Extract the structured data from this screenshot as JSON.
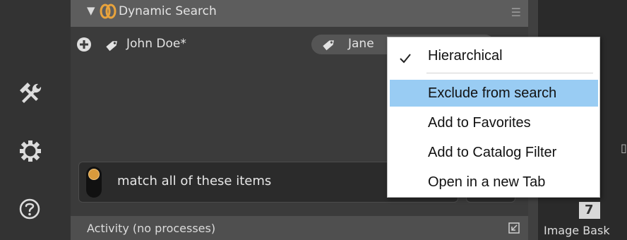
{
  "panel": {
    "header_title": "Dynamic Search",
    "tag_primary": "John Doe*",
    "tag_secondary": "Jane",
    "match_label": "match all of these items"
  },
  "activity": {
    "label": "Activity (no processes)"
  },
  "basket": {
    "count": "7",
    "label": "Image Bask"
  },
  "context_menu": {
    "items": [
      {
        "label": "Hierarchical",
        "checked": true
      },
      {
        "label": "Exclude from search",
        "highlighted": true
      },
      {
        "label": "Add to Favorites"
      },
      {
        "label": "Add to Catalog Filter"
      },
      {
        "label": "Open in a new Tab"
      }
    ]
  },
  "sidebar": {
    "icons": [
      "tools-icon",
      "gear-icon",
      "help-icon"
    ]
  },
  "colors": {
    "accent_orange": "#e8a33c",
    "menu_highlight": "#99ccf3"
  }
}
